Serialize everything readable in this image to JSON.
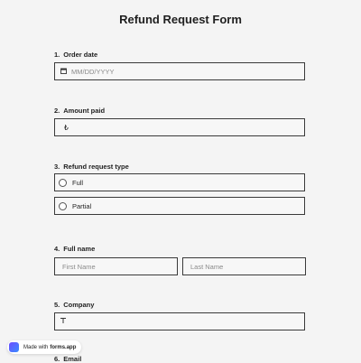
{
  "form": {
    "title": "Refund Request Form",
    "questions": [
      {
        "num": "1.",
        "label": "Order date",
        "icon": "calendar-icon",
        "placeholder": "MM/DD/YYYY"
      },
      {
        "num": "2.",
        "label": "Amount paid",
        "icon": "currency-icon",
        "value": "₺"
      },
      {
        "num": "3.",
        "label": "Refund request type",
        "options": [
          "Full",
          "Partial"
        ]
      },
      {
        "num": "4.",
        "label": "Full name",
        "first_placeholder": "First Name",
        "last_placeholder": "Last Name"
      },
      {
        "num": "5.",
        "label": "Company",
        "icon": "text-icon"
      },
      {
        "num": "6.",
        "label": "Email"
      }
    ]
  },
  "badge": {
    "prefix": "Made with",
    "brand": "forms.app"
  }
}
